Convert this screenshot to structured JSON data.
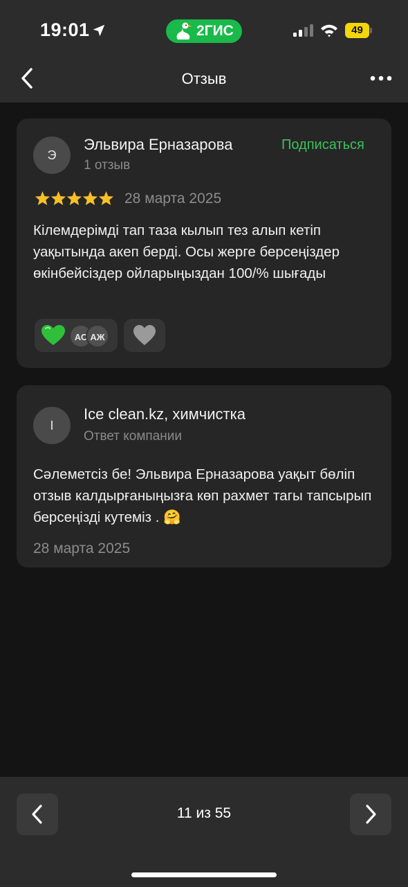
{
  "status_bar": {
    "time": "19:01",
    "brand": "2ГИС",
    "battery": "49"
  },
  "header": {
    "title": "Отзыв"
  },
  "review": {
    "avatar_initial": "Э",
    "author": "Эльвира Ерназарова",
    "author_reviews": "1 отзыв",
    "subscribe_label": "Подписаться",
    "rating": 5,
    "date": "28 марта 2025",
    "text": "Кілемдерімді тап таза кылып тез алып кетіп уақытында акеп берді. Осы жерге берсеңіздер өкінбейсіздер ойларыңыздан 100/% шығады",
    "reactions": {
      "emoji": "green-heart",
      "reactor_initials": [
        "АС",
        "АЖ"
      ]
    }
  },
  "reply": {
    "avatar_initial": "I",
    "company": "Ice clean.kz, химчистка",
    "label": "Ответ компании",
    "text": "Сәлеметсіз бе! Эльвира Ерназарова уақыт бөліп отзыв калдырғаныңызға көп рахмет тагы тапсырып берсеңізді кутеміз . 🤗",
    "date": "28 марта 2025"
  },
  "pager": {
    "text": "11 из 55"
  },
  "colors": {
    "accent_green": "#3bc25a",
    "brand_green": "#19b94a",
    "star_yellow": "#f7c028",
    "background": "#141414",
    "card": "#262626"
  }
}
